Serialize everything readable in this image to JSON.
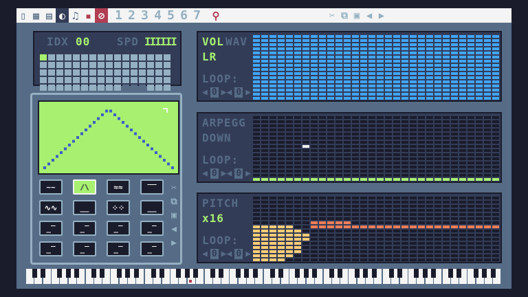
{
  "toolbar": {
    "left_icons": [
      {
        "glyph": "▯",
        "name": "code-editor-icon",
        "state": "normal"
      },
      {
        "glyph": "▦",
        "name": "sprite-editor-icon",
        "state": "normal"
      },
      {
        "glyph": "▤",
        "name": "map-editor-icon",
        "state": "normal"
      },
      {
        "glyph": "◐",
        "name": "sfx-editor-icon",
        "state": "active"
      },
      {
        "glyph": "♫",
        "name": "music-editor-icon",
        "state": "normal"
      },
      {
        "glyph": "▪",
        "name": "waveform-mode-icon",
        "state": "red"
      },
      {
        "glyph": "⊘",
        "name": "envelope-mode-icon",
        "state": "redsel"
      }
    ],
    "numbers": [
      "1",
      "2",
      "3",
      "4",
      "5",
      "6",
      "7"
    ],
    "pin_icon": "⚲",
    "right_icons": [
      {
        "glyph": "✂",
        "name": "cut-icon"
      },
      {
        "glyph": "⧉",
        "name": "copy-icon"
      },
      {
        "glyph": "▣",
        "name": "paste-icon"
      },
      {
        "glyph": "◀",
        "name": "undo-icon"
      },
      {
        "glyph": "▶",
        "name": "redo-icon"
      }
    ]
  },
  "index_panel": {
    "idx_label": "IDX",
    "idx_value": "00",
    "spd_label": "SPD",
    "spd_value": "IIIIII"
  },
  "wave_buttons": [
    "~~",
    "/\\",
    "≈≈",
    "‾‾",
    "∿∿",
    "__",
    "⁘⁘",
    "__",
    "_‾",
    "_‾",
    "_‾",
    "_‾",
    "_‾",
    "_‾",
    "_‾",
    "_‾"
  ],
  "side_icons": [
    "✂",
    "⧉",
    "▣",
    "◀",
    "▶"
  ],
  "volume": {
    "label": "VOL",
    "label2": "WAV",
    "mode": "LR",
    "loop_label": "LOOP:",
    "loop_start": "0",
    "loop_end": "0"
  },
  "arpeggio": {
    "label": "ARPEGG",
    "mode": "DOWN",
    "loop_label": "LOOP:",
    "loop_start": "0",
    "loop_end": "0"
  },
  "pitch": {
    "label": "PITCH",
    "mode": "x16",
    "loop_label": "LOOP:",
    "loop_start": "0",
    "loop_end": "0"
  },
  "colors": {
    "background": "#1a1c2c",
    "frame": "#566c86",
    "panel": "#333c57",
    "green": "#a7f070",
    "blue": "#41a6f6",
    "orange": "#ef7d57",
    "yellow": "#ffcd75",
    "red": "#b13e53"
  },
  "keyboard": {
    "octaves": 8,
    "pressed_octave": 2
  }
}
